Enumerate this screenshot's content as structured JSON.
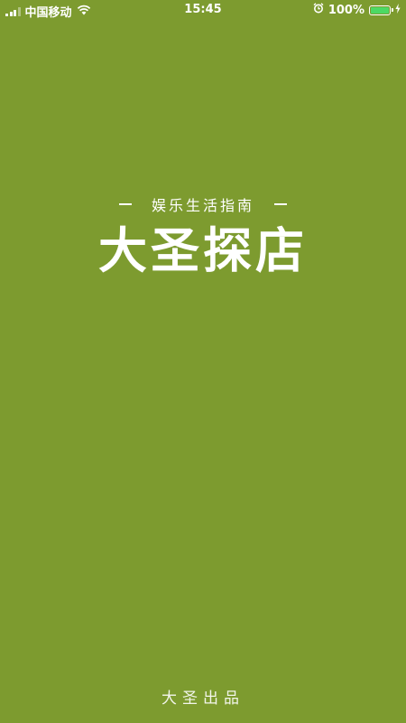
{
  "status_bar": {
    "carrier": "中国移动",
    "time": "15:45",
    "battery_percent": "100%",
    "battery_level": 1.0,
    "icons": [
      "signal-icon",
      "wifi-icon",
      "alarm-icon",
      "battery-icon",
      "charging-icon"
    ]
  },
  "splash": {
    "tagline": "娱乐生活指南",
    "title": "大圣探店"
  },
  "footer": {
    "text": "大圣出品"
  },
  "colors": {
    "background": "#7d9b2f",
    "text": "#ffffff",
    "battery": "#4cd964"
  }
}
